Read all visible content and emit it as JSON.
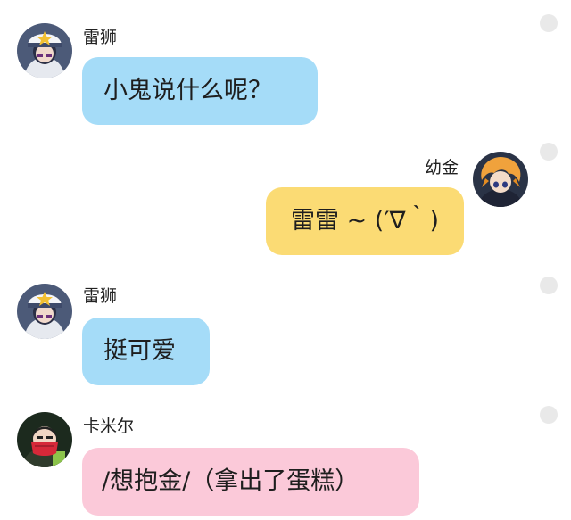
{
  "messages": [
    {
      "sender": "雷狮",
      "text": "小鬼说什么呢？",
      "bubble_color": "#a5dcf8",
      "avatar_icon": "leishi-avatar-icon"
    },
    {
      "sender": "幼金",
      "text": "雷雷 ~ (′∇｀)",
      "bubble_color": "#fbdb74",
      "avatar_icon": "youjin-avatar-icon"
    },
    {
      "sender": "雷狮",
      "text": "挺可爱",
      "bubble_color": "#a5dcf8",
      "avatar_icon": "leishi-avatar-icon"
    },
    {
      "sender": "卡米尔",
      "text": "/想抱金/（拿出了蛋糕）",
      "bubble_color": "#fbc9d9",
      "avatar_icon": "kamier-avatar-icon"
    }
  ]
}
